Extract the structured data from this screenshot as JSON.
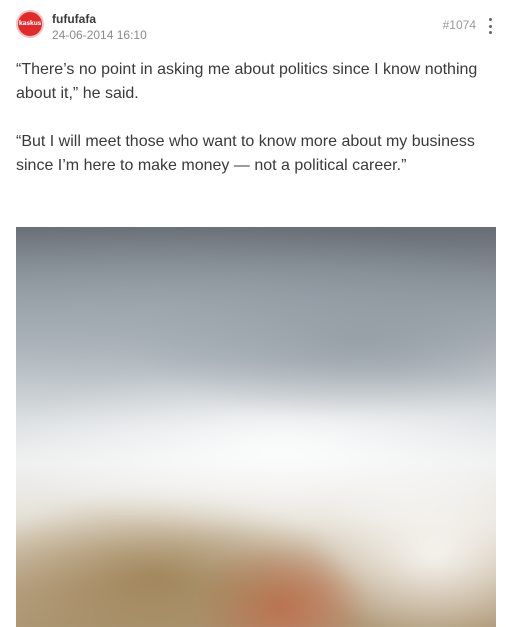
{
  "post": {
    "author": {
      "username": "fufufafa",
      "avatar_text": "kaskus"
    },
    "timestamp": "24-06-2014 16:10",
    "post_number": "#1074",
    "more_icon": "kebab-menu-icon",
    "paragraphs": [
      "“There’s no point in asking me about politics since I know nothing about it,” he said.",
      "“But I will meet those who want to know more about my business since I’m here to make money — not a political career.”"
    ]
  },
  "colors": {
    "avatar_bg": "#e32a2a",
    "muted_text": "#8a8a8a",
    "body_text": "#3a3a3a"
  }
}
